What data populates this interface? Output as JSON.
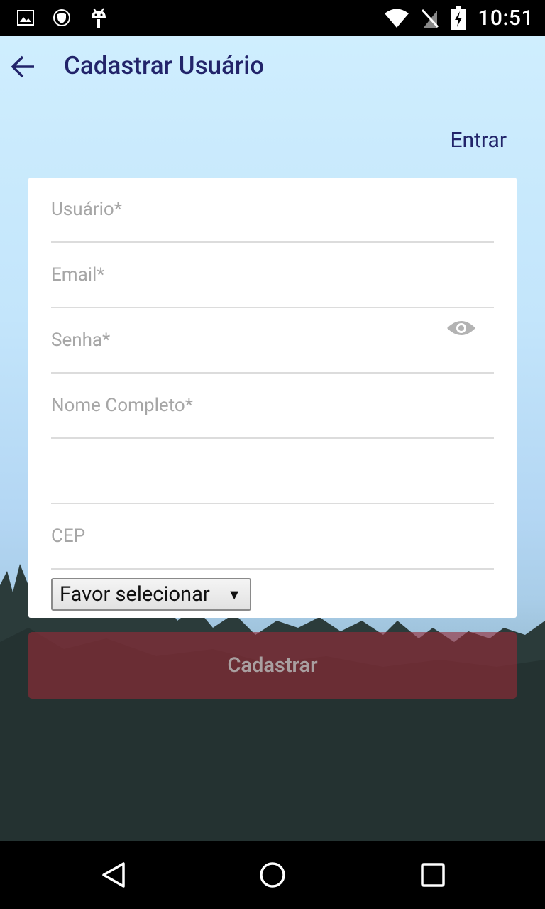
{
  "status_bar": {
    "time": "10:51",
    "icons": [
      "image-icon",
      "shield-icon",
      "android-icon",
      "wifi-icon",
      "no-sim-icon",
      "battery-charging-icon"
    ]
  },
  "app_bar": {
    "title": "Cadastrar Usuário",
    "back_icon": "arrow-left-icon"
  },
  "login_link": "Entrar",
  "form": {
    "fields": [
      {
        "placeholder": "Usuário*",
        "value": ""
      },
      {
        "placeholder": "Email*",
        "value": ""
      },
      {
        "placeholder": "Senha*",
        "value": ""
      },
      {
        "placeholder": "Nome Completo*",
        "value": ""
      },
      {
        "placeholder": "",
        "value": ""
      },
      {
        "placeholder": "CEP",
        "value": ""
      }
    ],
    "select_value": "Favor selecionar",
    "select_arrow": "▼",
    "submit_label": "Cadastrar"
  },
  "colors": {
    "title": "#22246a",
    "submit_bg": "#962a37",
    "placeholder": "#a6a6a6"
  },
  "nav_bar": {
    "icons": [
      "back-triangle-icon",
      "home-circle-icon",
      "recents-square-icon"
    ]
  }
}
